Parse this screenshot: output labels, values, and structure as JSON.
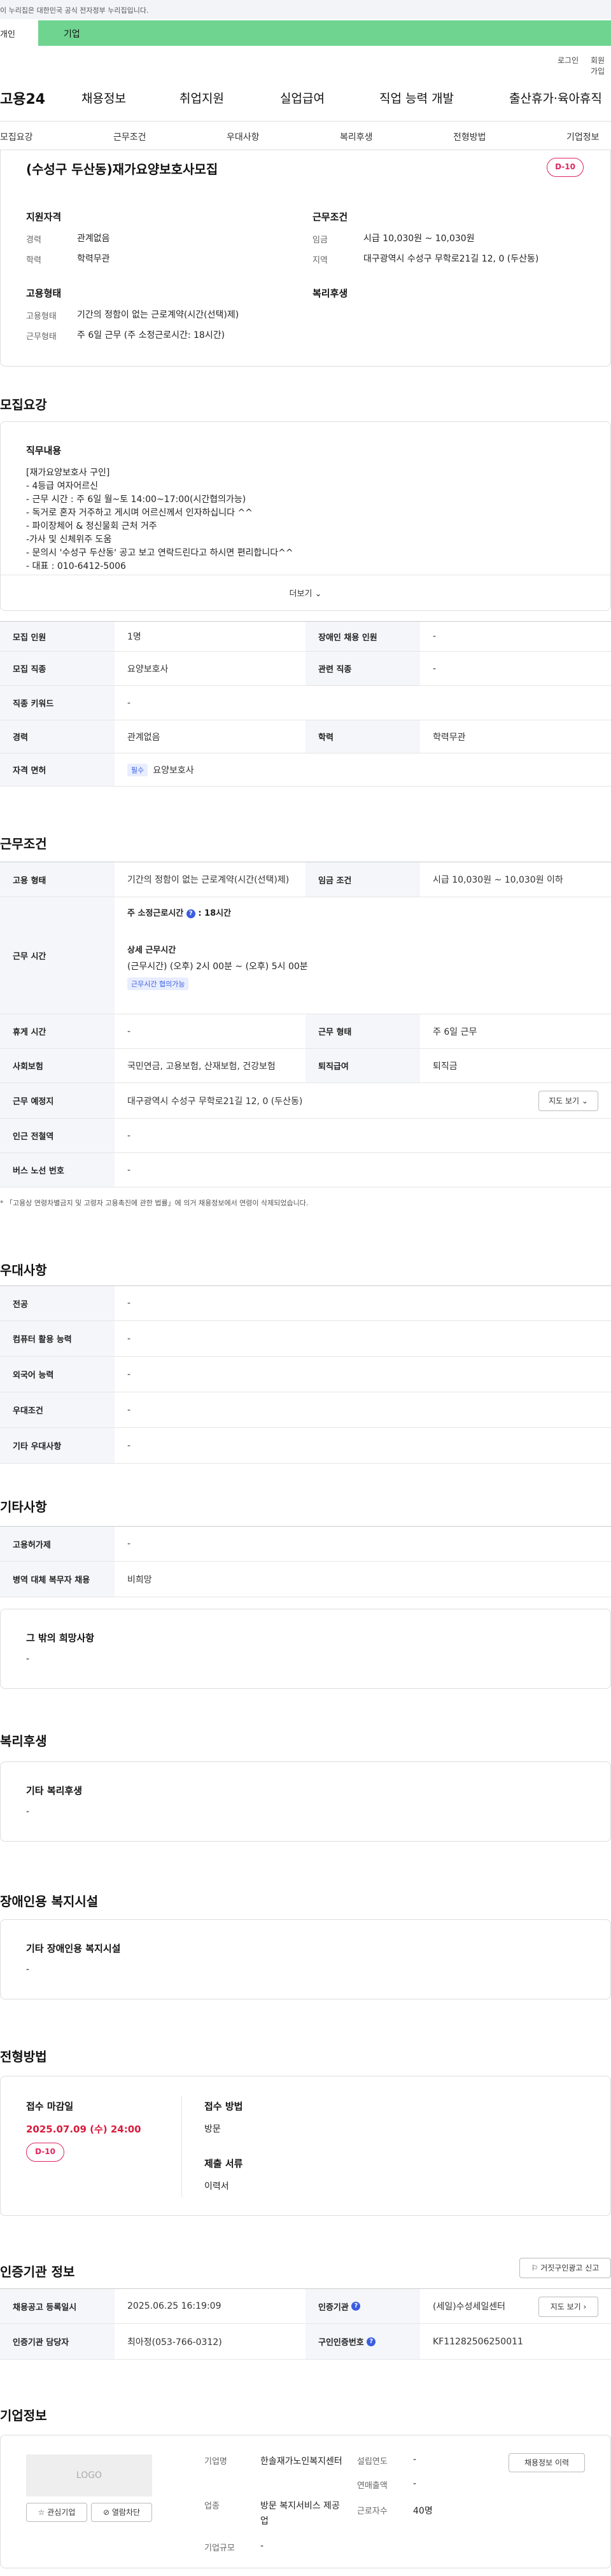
{
  "gov_banner": "이 누리집은 대한민국 공식 전자정부 누리집입니다.",
  "top_tabs": {
    "personal": "개인",
    "company": "기업"
  },
  "util": {
    "login": "로그인",
    "join": "회원가입"
  },
  "logo": "고용24",
  "gnb": [
    "채용정보",
    "취업지원",
    "실업급여",
    "직업 능력 개발",
    "출산휴가·육아휴직"
  ],
  "subnav": [
    "모집요강",
    "근무조건",
    "우대사항",
    "복리후생",
    "전형방법",
    "기업정보"
  ],
  "job_title": "(수성구 두산동)재가요양보호사모집",
  "dday": "D-10",
  "summary": {
    "qual_title": "지원자격",
    "career_l": "경력",
    "career_v": "관계없음",
    "edu_l": "학력",
    "edu_v": "학력무관",
    "cond_title": "근무조건",
    "wage_l": "임금",
    "wage_v": "시급 10,030원 ~ 10,030원",
    "region_l": "지역",
    "region_v": "대구광역시 수성구 무학로21길 12, 0 (두산동)",
    "emp_title": "고용형태",
    "emptype_l": "고용형태",
    "emptype_v": "기간의 정함이 없는 근로계약(시간(선택)제)",
    "worktype_l": "근무형태",
    "worktype_v": "주 6일 근무 (주 소정근로시간: 18시간)",
    "welfare_title": "복리후생"
  },
  "recruit": {
    "section": "모집요강",
    "duty_title": "직무내용",
    "duty_text": "[재가요양보호사 구인]\n- 4등급 여자어르신\n- 근무 시간 : 주 6일 월~토 14:00~17:00(시간협의가능)\n- 독거로 혼자 거주하고 게시며 어르신께서 인자하십니다 ^^\n- 파이장체어 & 정신물회 근처 거주\n-가사 및 신체위주 도움\n- 문의시 '수성구 두산동' 공고 보고 연락드린다고 하시면 편리합니다^^\n- 대표 : 010-6412-5006",
    "more": "더보기",
    "count_l": "모집 인원",
    "count_v": "1명",
    "disabled_l": "장애인 채용 인원",
    "disabled_v": "-",
    "job_l": "모집 직종",
    "job_v": "요양보호사",
    "related_l": "관련 직종",
    "related_v": "-",
    "keyword_l": "직종 키워드",
    "keyword_v": "-",
    "career_l": "경력",
    "career_v": "관계없음",
    "edu_l": "학력",
    "edu_v": "학력무관",
    "license_l": "자격 면허",
    "license_tag": "필수",
    "license_v": "요양보호사"
  },
  "work": {
    "section": "근무조건",
    "emptype_l": "고용 형태",
    "emptype_v": "기간의 정함이 없는 근로계약(시간(선택)제)",
    "wage_l": "임금 조건",
    "wage_v": "시급 10,030원 ~ 10,030원 이하",
    "hours_l": "근무 시간",
    "weekly": "주 소정근로시간",
    "weekly_v": ": 18시간",
    "detail": "상세 근무시간",
    "detail_v": "(근무시간) (오후) 2시 00분 ~ (오후) 5시 00분",
    "nego": "근무시간 협의가능",
    "break_l": "휴게 시간",
    "break_v": "-",
    "form_l": "근무 형태",
    "form_v": "주 6일 근무",
    "insurance_l": "사회보험",
    "insurance_v": "국민연금, 고용보험, 산재보험, 건강보험",
    "retire_l": "퇴직급여",
    "retire_v": "퇴직금",
    "place_l": "근무 예정지",
    "place_v": "대구광역시 수성구 무학로21길 12, 0 (두산동)",
    "map": "지도 보기",
    "subway_l": "인근 전철역",
    "subway_v": "-",
    "bus_l": "버스 노선 번호",
    "bus_v": "-",
    "note": "「고용상 연령차별금지 및 고령자 고용촉진에 관한 법률」에 의거 채용정보에서 연령이 삭제되었습니다."
  },
  "pref": {
    "section": "우대사항",
    "rows": [
      {
        "l": "전공",
        "v": "-"
      },
      {
        "l": "컴퓨터 활용 능력",
        "v": "-"
      },
      {
        "l": "외국어 능력",
        "v": "-"
      },
      {
        "l": "우대조건",
        "v": "-"
      },
      {
        "l": "기타 우대사항",
        "v": "-"
      }
    ]
  },
  "etc": {
    "section": "기타사항",
    "hire_l": "고용허가제",
    "hire_v": "-",
    "military_l": "병역 대체 복무자 채용",
    "military_v": "비희망",
    "other_title": "그 밖의 희망사항",
    "other_v": "-"
  },
  "welfare": {
    "section": "복리후생",
    "title": "기타 복리후생",
    "v": "-"
  },
  "facility": {
    "section": "장애인용 복지시설",
    "title": "기타 장애인용 복지시설",
    "v": "-"
  },
  "process": {
    "section": "전형방법",
    "deadline_l": "접수 마감일",
    "deadline_v": "2025.07.09 (수) 24:00",
    "dday": "D-10",
    "method_l": "접수 방법",
    "method_v": "방문",
    "docs_l": "제출 서류",
    "docs_v": "이력서"
  },
  "agency": {
    "section": "인증기관 정보",
    "report": "거짓구인광고 신고",
    "reg_l": "채용공고 등록일시",
    "reg_v": "2025.06.25 16:19:09",
    "org_l": "인증기관",
    "org_v": "(세일)수성세일센터",
    "map": "지도 보기",
    "mgr_l": "인증기관 담당자",
    "mgr_v": "최아정(053-766-0312)",
    "no_l": "구인인증번호",
    "no_v": "KF11282506250011"
  },
  "company": {
    "section": "기업정보",
    "logo": "LOGO",
    "fav": "관심기업",
    "block": "열람차단",
    "name_l": "기업명",
    "name_v": "한솔재가노인복지센터",
    "found_l": "설립연도",
    "found_v": "-",
    "sales_l": "연매출액",
    "sales_v": "-",
    "biz_l": "업종",
    "biz_v": "방문 복지서비스 제공업",
    "emp_l": "근로자수",
    "emp_v": "40명",
    "size_l": "기업규모",
    "size_v": "-",
    "history": "채용정보 이력"
  },
  "colors": {
    "accent_green": "#6ed48f",
    "dday_red": "#e0245e",
    "deadline_red": "#d81b3c"
  }
}
